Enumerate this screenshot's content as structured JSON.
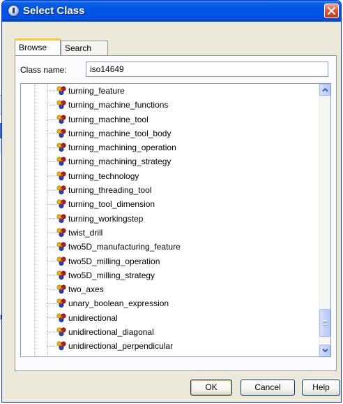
{
  "window": {
    "title": "Select Class"
  },
  "tabs": [
    {
      "label": "Browse",
      "active": true
    },
    {
      "label": "Search",
      "active": false
    }
  ],
  "class_name": {
    "label": "Class name:",
    "value": "iso14649"
  },
  "tree": {
    "items": [
      "turning_feature",
      "turning_machine_functions",
      "turning_machine_tool",
      "turning_machine_tool_body",
      "turning_machining_operation",
      "turning_machining_strategy",
      "turning_technology",
      "turning_threading_tool",
      "turning_tool_dimension",
      "turning_workingstep",
      "twist_drill",
      "two5D_manufacturing_feature",
      "two5D_milling_operation",
      "two5D_milling_strategy",
      "two_axes",
      "unary_boolean_expression",
      "unidirectional",
      "unidirectional_diagonal",
      "unidirectional_perpendicular"
    ],
    "item_icon": "class-node-icon",
    "scroll_position": 0.88
  },
  "buttons": {
    "ok": "OK",
    "cancel": "Cancel",
    "help": "Help"
  },
  "background": {
    "fragment_text": "m"
  },
  "colors": {
    "titlebar": "#0054e3",
    "dialog_bg": "#ece9d8",
    "close": "#e1583a",
    "tab_highlight": "#ffc83c"
  }
}
